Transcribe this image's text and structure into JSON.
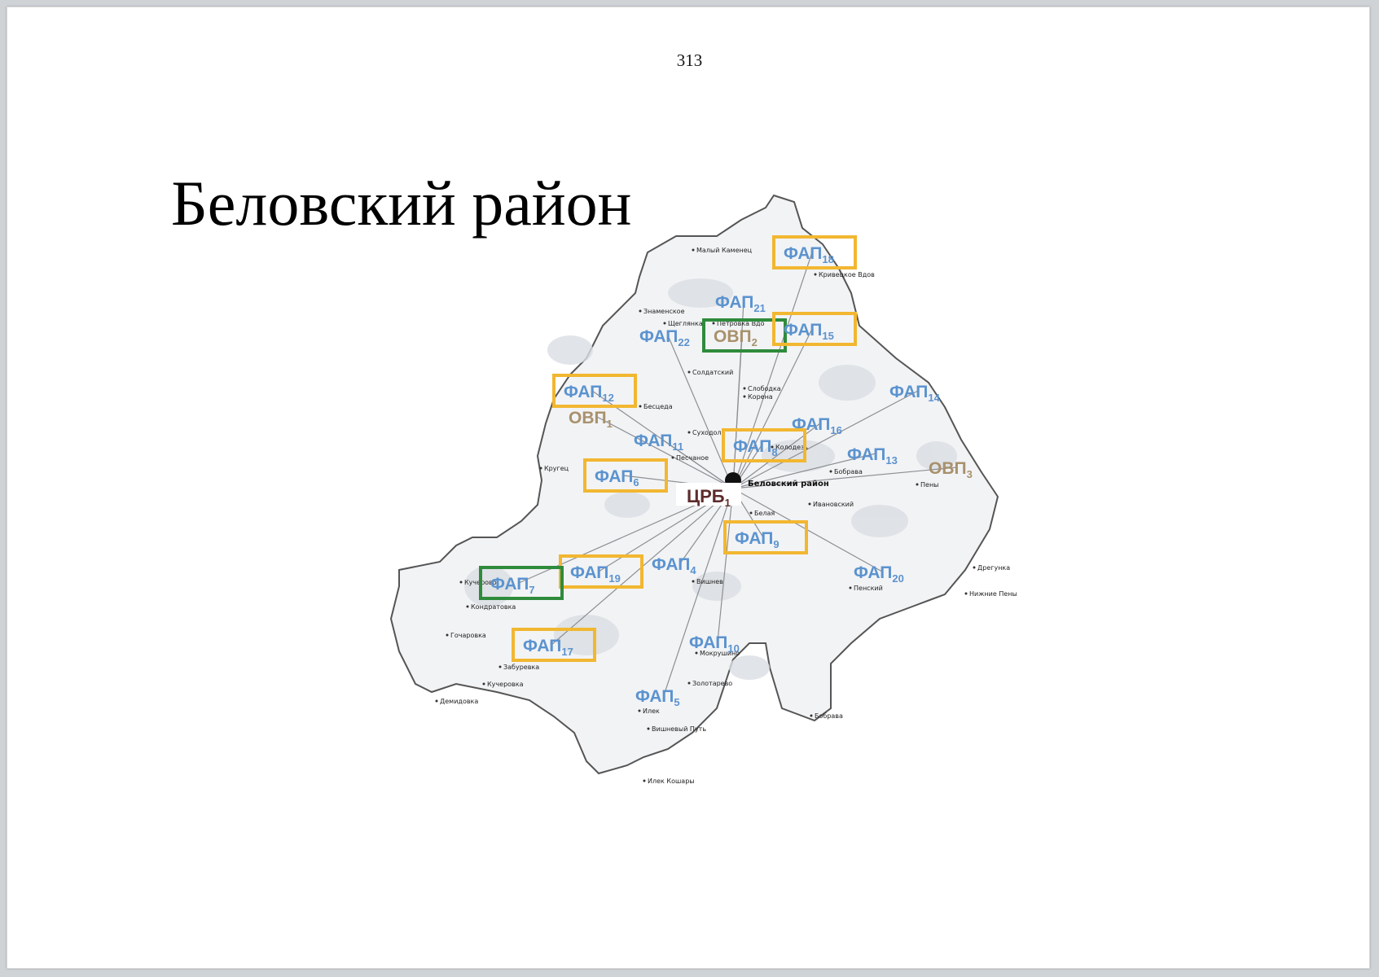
{
  "page_number": "313",
  "title": "Беловский район",
  "district_center_label": "Беловский район",
  "colors": {
    "fap_text": "#5b93cf",
    "ovp_text": "#a8916c",
    "crb_text": "#5e2b2b",
    "yellow_frame": "#f2b731",
    "green_frame": "#2f8b3c",
    "map_fill": "#f2f3f5",
    "map_border": "#555555"
  },
  "hub": {
    "name": "ЦРБ",
    "sub": "1"
  },
  "facilities": [
    {
      "name": "ФАП",
      "sub": "18",
      "frame": "yellow"
    },
    {
      "name": "ФАП",
      "sub": "21",
      "frame": "none"
    },
    {
      "name": "ФАП",
      "sub": "22",
      "frame": "none"
    },
    {
      "name": "ОВП",
      "sub": "2",
      "frame": "green"
    },
    {
      "name": "ФАП",
      "sub": "15",
      "frame": "yellow"
    },
    {
      "name": "ФАП",
      "sub": "12",
      "frame": "yellow"
    },
    {
      "name": "ОВП",
      "sub": "1",
      "frame": "none"
    },
    {
      "name": "ФАП",
      "sub": "14",
      "frame": "none"
    },
    {
      "name": "ФАП",
      "sub": "16",
      "frame": "none"
    },
    {
      "name": "ФАП",
      "sub": "11",
      "frame": "none"
    },
    {
      "name": "ФАП",
      "sub": "8",
      "frame": "yellow"
    },
    {
      "name": "ФАП",
      "sub": "13",
      "frame": "none"
    },
    {
      "name": "ОВП",
      "sub": "3",
      "frame": "none"
    },
    {
      "name": "ФАП",
      "sub": "6",
      "frame": "yellow"
    },
    {
      "name": "ФАП",
      "sub": "9",
      "frame": "yellow"
    },
    {
      "name": "ФАП",
      "sub": "19",
      "frame": "yellow"
    },
    {
      "name": "ФАП",
      "sub": "4",
      "frame": "none"
    },
    {
      "name": "ФАП",
      "sub": "7",
      "frame": "green"
    },
    {
      "name": "ФАП",
      "sub": "20",
      "frame": "none"
    },
    {
      "name": "ФАП",
      "sub": "10",
      "frame": "none"
    },
    {
      "name": "ФАП",
      "sub": "17",
      "frame": "yellow"
    },
    {
      "name": "ФАП",
      "sub": "5",
      "frame": "none"
    }
  ],
  "settlements": [
    "Малый Каменец",
    "Кривецкое Вдов",
    "Знаменское",
    "Щеглянка",
    "Петровка Вдо",
    "Солдатский",
    "Слободка",
    "Корена",
    "Бесцеда",
    "Суходол",
    "Песчаное",
    "Кругец",
    "Колодезь",
    "Бобрава",
    "Пены",
    "Ивановский",
    "Белая",
    "Кучерово",
    "Кондратовка",
    "Гочаровка",
    "Забуревка",
    "Вишнев",
    "Мокрушино",
    "Золотарево",
    "Илек",
    "Пенский",
    "Дрегунка",
    "Нижние Пены",
    "Бобрава",
    "Вишневый Путь",
    "Илек Кошары",
    "Демидовка",
    "Кучеровка"
  ]
}
